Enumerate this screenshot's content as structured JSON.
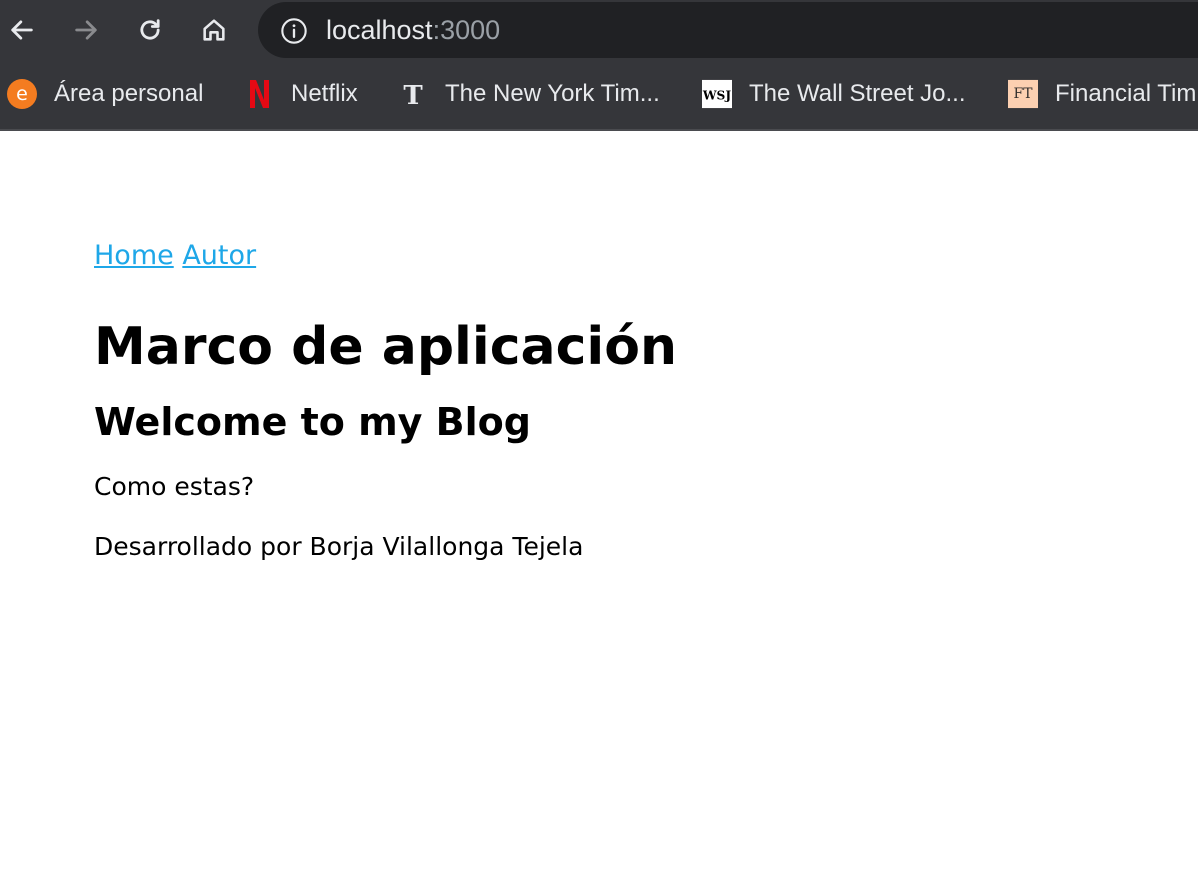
{
  "browser": {
    "url_host": "localhost",
    "url_port": ":3000",
    "bookmarks": [
      {
        "label": "Área personal",
        "icon": "e-orange-icon",
        "favicon_text": "e"
      },
      {
        "label": "Netflix",
        "icon": "netflix-icon",
        "favicon_text": "N"
      },
      {
        "label": "The New York Tim...",
        "icon": "nyt-icon",
        "favicon_text": "T"
      },
      {
        "label": "The Wall Street Jo...",
        "icon": "wsj-icon",
        "favicon_text": "WSJ"
      },
      {
        "label": "Financial Tim",
        "icon": "ft-icon",
        "favicon_text": "FT"
      }
    ]
  },
  "page": {
    "nav": {
      "home": "Home",
      "autor": "Autor"
    },
    "title": "Marco de aplicación",
    "heading": "Welcome to my Blog",
    "body": "Como estas?",
    "footer": "Desarrollado por Borja Vilallonga Tejela"
  },
  "colors": {
    "chrome_bg": "#35363a",
    "omnibox_bg": "#202124",
    "link": "#1ea7e8",
    "netflix_red": "#e50914",
    "area_orange": "#f47c20",
    "ft_bg": "#fcd0b1"
  }
}
